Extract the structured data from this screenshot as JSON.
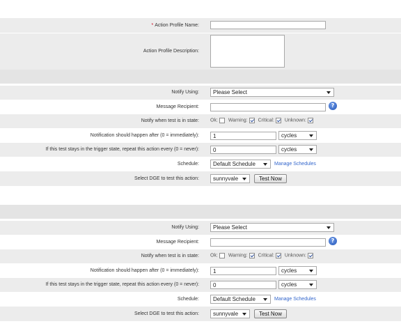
{
  "profile": {
    "name_label": "Action Profile Name:",
    "required_mark": "*",
    "name_value": "",
    "description_label": "Action Profile Description:",
    "description_value": ""
  },
  "actions": [
    {
      "notify_using_label": "Notify Using:",
      "notify_using_value": "Please Select",
      "recipient_label": "Message Recipient:",
      "recipient_value": "",
      "state_label": "Notify when test is in state:",
      "states": [
        {
          "label": "Ok:",
          "checked": false
        },
        {
          "label": "Warning:",
          "checked": true
        },
        {
          "label": "Critical:",
          "checked": true
        },
        {
          "label": "Unknown:",
          "checked": true
        }
      ],
      "after_label": "Notification should happen after (0 = immediately):",
      "after_value": "1",
      "after_unit": "cycles",
      "repeat_label": "If this test stays in the trigger state, repeat this action every (0 = never):",
      "repeat_value": "0",
      "repeat_unit": "cycles",
      "schedule_label": "Schedule:",
      "schedule_value": "Default Schedule",
      "manage_link": "Manage Schedules",
      "dge_label": "Select DGE to test this action:",
      "dge_value": "sunnyvale",
      "test_button": "Test Now"
    },
    {
      "notify_using_label": "Notify Using:",
      "notify_using_value": "Please Select",
      "recipient_label": "Message Recipient:",
      "recipient_value": "",
      "state_label": "Notify when test is in state:",
      "states": [
        {
          "label": "Ok:",
          "checked": false
        },
        {
          "label": "Warning:",
          "checked": true
        },
        {
          "label": "Critical:",
          "checked": true
        },
        {
          "label": "Unknown:",
          "checked": true
        }
      ],
      "after_label": "Notification should happen after (0 = immediately):",
      "after_value": "1",
      "after_unit": "cycles",
      "repeat_label": "If this test stays in the trigger state, repeat this action every (0 = never):",
      "repeat_value": "0",
      "repeat_unit": "cycles",
      "schedule_label": "Schedule:",
      "schedule_value": "Default Schedule",
      "manage_link": "Manage Schedules",
      "dge_label": "Select DGE to test this action:",
      "dge_value": "sunnyvale",
      "test_button": "Test Now"
    }
  ],
  "icons": {
    "help": "help-icon"
  }
}
